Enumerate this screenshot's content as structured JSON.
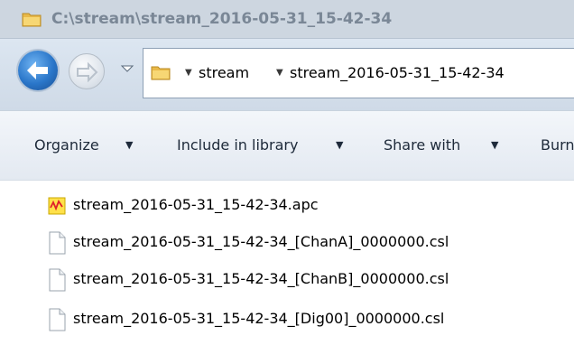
{
  "window": {
    "title": "C:\\stream\\stream_2016-05-31_15-42-34"
  },
  "navigation": {
    "back_icon": "back-arrow-icon",
    "forward_icon": "forward-arrow-icon",
    "history_icon": "chevron-down-icon"
  },
  "address_bar": {
    "icon": "folder-icon",
    "crumbs": [
      "stream",
      "stream_2016-05-31_15-42-34"
    ]
  },
  "toolbar": {
    "organize_label": "Organize",
    "include_label": "Include in library",
    "share_label": "Share with",
    "burn_label": "Burn"
  },
  "files": [
    {
      "name": "stream_2016-05-31_15-42-34.apc",
      "icon": "apc-file-icon"
    },
    {
      "name": "stream_2016-05-31_15-42-34_[ChanA]_0000000.csl",
      "icon": "blank-file-icon"
    },
    {
      "name": "stream_2016-05-31_15-42-34_[ChanB]_0000000.csl",
      "icon": "blank-file-icon"
    },
    {
      "name": "stream_2016-05-31_15-42-34_[Dig00]_0000000.csl",
      "icon": "blank-file-icon"
    }
  ],
  "colors": {
    "titlebar": "#cdd6e0",
    "title_text": "#7a8796",
    "back_button": "#2a76c9",
    "folder": "#f2c94c",
    "apc_icon_bg": "#ffe14a",
    "apc_icon_wave": "#e0202a"
  }
}
